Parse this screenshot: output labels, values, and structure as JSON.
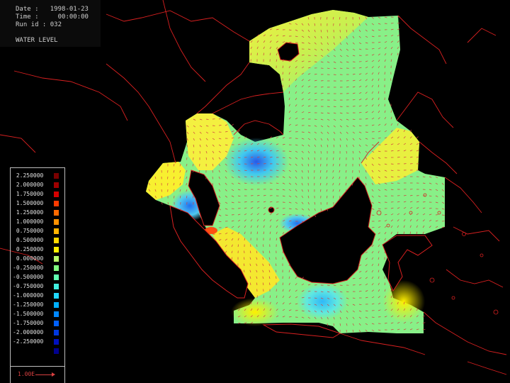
{
  "header": {
    "date_line": "Date :   1998-01-23",
    "time_line": "Time :     00:00:00",
    "run_line": "Run id : 032",
    "field_line": "WATER LEVEL"
  },
  "legend": {
    "entries": [
      {
        "label": " 2.250000",
        "color": "#7a0000"
      },
      {
        "label": " 2.000000",
        "color": "#a00000"
      },
      {
        "label": " 1.750000",
        "color": "#d40000"
      },
      {
        "label": " 1.500000",
        "color": "#ff3a00"
      },
      {
        "label": " 1.250000",
        "color": "#ff6a00"
      },
      {
        "label": " 1.000000",
        "color": "#ff9200"
      },
      {
        "label": " 0.750000",
        "color": "#ffb400"
      },
      {
        "label": " 0.500000",
        "color": "#ffd800"
      },
      {
        "label": " 0.250000",
        "color": "#fff000"
      },
      {
        "label": " 0.000000",
        "color": "#b8ff6a"
      },
      {
        "label": "-0.250000",
        "color": "#80ff80"
      },
      {
        "label": "-0.500000",
        "color": "#60ffb0"
      },
      {
        "label": "-0.750000",
        "color": "#40f0e0"
      },
      {
        "label": "-1.000000",
        "color": "#20d8ff"
      },
      {
        "label": "-1.250000",
        "color": "#00b0ff"
      },
      {
        "label": "-1.500000",
        "color": "#0088ff"
      },
      {
        "label": "-1.750000",
        "color": "#0060ff"
      },
      {
        "label": "-2.000000",
        "color": "#0038e0"
      },
      {
        "label": "-2.250000",
        "color": "#0010c0"
      }
    ],
    "last_color": "#000090",
    "vector_scale": "1.00E"
  },
  "colors": {
    "coast": "#d82020",
    "sea_base": "#88f088",
    "vector": "#e04040"
  }
}
